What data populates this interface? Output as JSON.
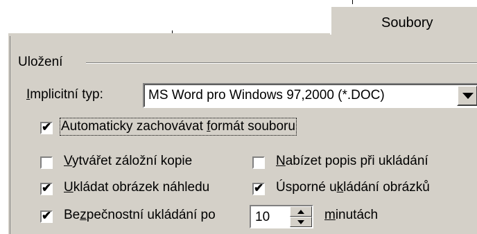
{
  "tabs": [
    {
      "label": "Soubory",
      "active": true
    }
  ],
  "group": {
    "title": "Uložení"
  },
  "default_type": {
    "label_mnemonic": "I",
    "label_rest": "mplicitní typ:",
    "value": "MS Word pro Windows 97,2000 (*.DOC)"
  },
  "options": {
    "auto_keep_format": {
      "pre": "Automaticky zachovávat ",
      "mnemonic": "f",
      "post": "ormát souboru",
      "checked": true
    },
    "backup_copy": {
      "pre": "",
      "mnemonic": "V",
      "post": "ytvářet záložní kopie",
      "checked": false
    },
    "ask_description": {
      "pre": "",
      "mnemonic": "N",
      "post": "abízet popis při ukládání",
      "checked": false
    },
    "save_preview": {
      "pre": "",
      "mnemonic": "U",
      "post": "kládat obrázek náhledu",
      "checked": true
    },
    "efficient_images": {
      "pre": "Úsporné u",
      "mnemonic": "k",
      "post": "ládání obrázků",
      "checked": true
    },
    "safe_save": {
      "pre": "Be",
      "mnemonic": "z",
      "post": "pečnostní ukládání po",
      "checked": true
    }
  },
  "autosave": {
    "interval": "10",
    "unit_mnemonic": "m",
    "unit_rest": "inutách"
  },
  "colors": {
    "face": "#d4d0c8",
    "highlight": "#ffffff",
    "shadow": "#808080"
  }
}
